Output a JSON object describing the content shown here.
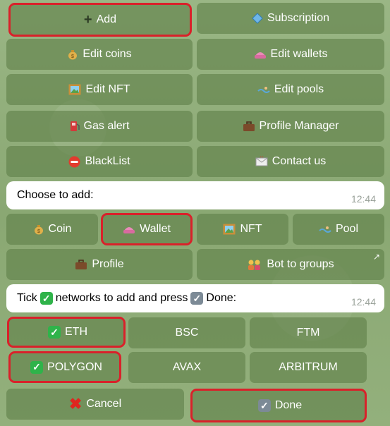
{
  "menu": {
    "add": "Add",
    "subscription": "Subscription",
    "edit_coins": "Edit coins",
    "edit_wallets": "Edit wallets",
    "edit_nft": "Edit NFT",
    "edit_pools": "Edit pools",
    "gas_alert": "Gas alert",
    "profile_manager": "Profile Manager",
    "blacklist": "BlackList",
    "contact_us": "Contact us"
  },
  "message1": {
    "text": "Choose to add:",
    "time": "12:44"
  },
  "add_options": {
    "coin": "Coin",
    "wallet": "Wallet",
    "nft": "NFT",
    "pool": "Pool",
    "profile": "Profile",
    "bot_to_groups": "Bot to groups"
  },
  "message2": {
    "text_prefix": "Tick",
    "text_middle": "networks to add and press",
    "text_suffix": "Done:",
    "time": "12:44"
  },
  "networks": {
    "eth": "ETH",
    "bsc": "BSC",
    "ftm": "FTM",
    "polygon": "POLYGON",
    "avax": "AVAX",
    "arbitrum": "ARBITRUM"
  },
  "actions": {
    "cancel": "Cancel",
    "done": "Done"
  },
  "colors": {
    "highlight": "#d9212a",
    "button_bg": "#6a8a52",
    "check_green": "#2fb34a"
  }
}
